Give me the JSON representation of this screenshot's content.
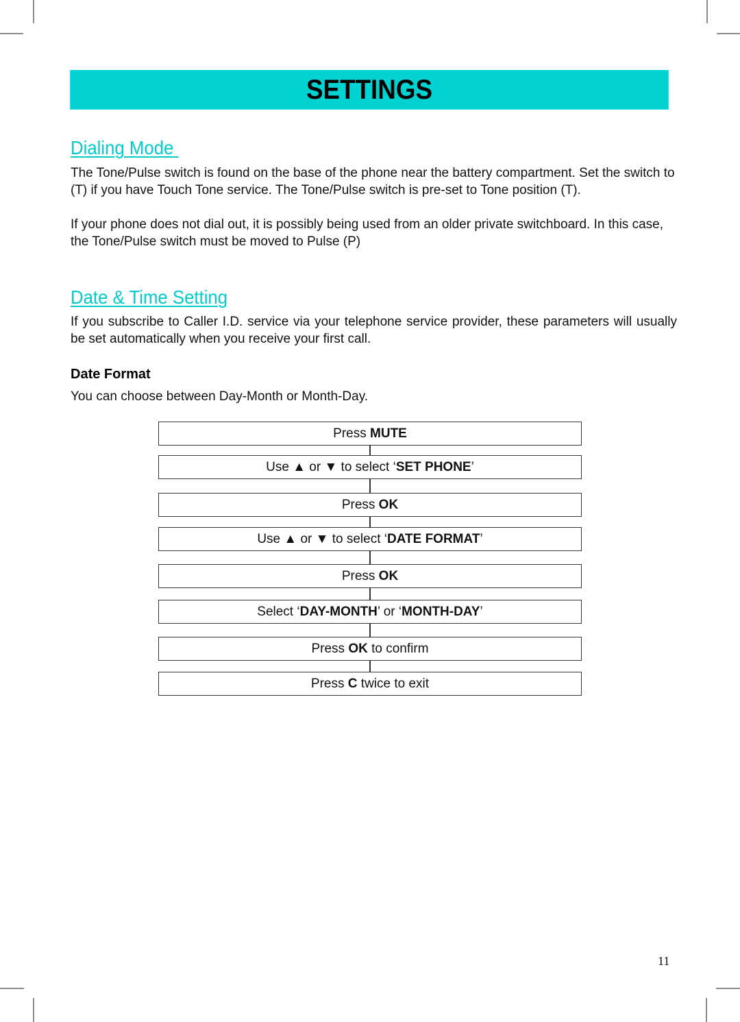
{
  "banner": {
    "title": "SETTINGS",
    "color": "#00d1d1"
  },
  "sections": [
    {
      "heading": "Dialing Mode ",
      "paragraphs": [
        "The Tone/Pulse switch is found on the base of the phone near the battery compartment.  Set the switch to (T) if you have Touch Tone service.  The Tone/Pulse switch is pre-set to Tone position (T).",
        "If your phone does not dial out, it is possibly being used from an older private switchboard. In this case, the Tone/Pulse switch must be moved to Pulse (P)"
      ]
    },
    {
      "heading": "Date & Time Setting",
      "paragraphs": [
        "If you subscribe to Caller I.D. service via your telephone service provider, these parameters will usually be set automatically when you receive your first call."
      ]
    }
  ],
  "date_format": {
    "heading": "Date Format",
    "intro": "You can choose between Day-Month or Month-Day.",
    "steps": [
      [
        {
          "t": "Press ",
          "b": false
        },
        {
          "t": "MUTE",
          "b": true
        }
      ],
      [
        {
          "t": "Use ▲ or ▼ to select ‘",
          "b": false
        },
        {
          "t": "SET PHONE",
          "b": true
        },
        {
          "t": "’",
          "b": false
        }
      ],
      [
        {
          "t": "Press ",
          "b": false
        },
        {
          "t": "OK",
          "b": true
        }
      ],
      [
        {
          "t": "Use ▲ or ▼ to select ‘",
          "b": false
        },
        {
          "t": "DATE FORMAT",
          "b": true
        },
        {
          "t": "’",
          "b": false
        }
      ],
      [
        {
          "t": "Press ",
          "b": false
        },
        {
          "t": "OK",
          "b": true
        }
      ],
      [
        {
          "t": "Select ‘",
          "b": false
        },
        {
          "t": "DAY-MONTH",
          "b": true
        },
        {
          "t": "’ or ‘",
          "b": false
        },
        {
          "t": "MONTH-DAY",
          "b": true
        },
        {
          "t": "’",
          "b": false
        }
      ],
      [
        {
          "t": "Press ",
          "b": false
        },
        {
          "t": "OK",
          "b": true
        },
        {
          "t": " to confirm",
          "b": false
        }
      ],
      [
        {
          "t": "Press ",
          "b": false
        },
        {
          "t": "C",
          "b": true
        },
        {
          "t": " twice to exit",
          "b": false
        }
      ]
    ]
  },
  "page_number": "11"
}
